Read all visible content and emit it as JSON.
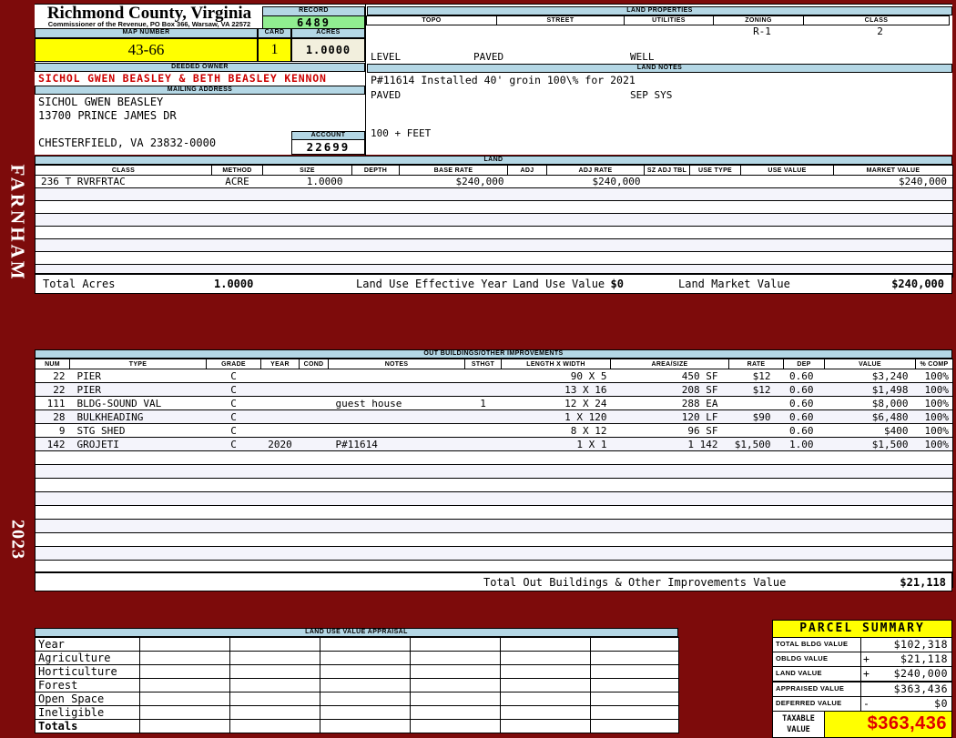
{
  "sidebar": {
    "district": "FARNHAM",
    "year": "2023"
  },
  "header": {
    "county_title": "Richmond County, Virginia",
    "county_subtitle": "Commissioner of the Revenue, PO Box 366, Warsaw, VA 22572",
    "record_label": "RECORD",
    "record_value": "6489",
    "map_number_label": "MAP NUMBER",
    "map_number_value": "43-66",
    "card_label": "CARD",
    "card_value": "1",
    "acres_label": "ACRES",
    "acres_value": "1.0000",
    "deeded_owner_label": "DEEDED OWNER",
    "deeded_owner": "SICHOL GWEN BEASLEY & BETH BEASLEY KENNON",
    "mailing_address_label": "MAILING ADDRESS",
    "mailing_address": [
      "SICHOL GWEN BEASLEY",
      "13700 PRINCE JAMES DR",
      "",
      "CHESTERFIELD, VA 23832-0000"
    ],
    "account_label": "ACCOUNT",
    "account_value": "22699"
  },
  "land_properties": {
    "title": "LAND PROPERTIES",
    "headers": [
      "TOPO",
      "STREET",
      "UTILITIES",
      "ZONING",
      "CLASS"
    ],
    "topo": [
      "LEVEL",
      "PAVED",
      "100 + FEET"
    ],
    "street": [
      "PAVED"
    ],
    "utilities": [
      "WELL",
      "SEP SYS"
    ],
    "zoning": "R-1",
    "class": "2"
  },
  "land_notes": {
    "title": "LAND NOTES",
    "text": "P#11614 Installed 40' groin 100\\% for 2021"
  },
  "land": {
    "title": "LAND",
    "headers": [
      "CLASS",
      "METHOD",
      "SIZE",
      "DEPTH",
      "BASE RATE",
      "ADJ",
      "ADJ RATE",
      "SZ ADJ TBL",
      "USE TYPE",
      "USE VALUE",
      "MARKET VALUE"
    ],
    "rows": [
      [
        "236 T RVRFRTAC",
        "ACRE",
        "1.0000",
        "",
        "$240,000",
        "",
        "$240,000",
        "",
        "",
        "",
        "$240,000"
      ]
    ],
    "totals": {
      "total_acres_label": "Total Acres",
      "total_acres": "1.0000",
      "effective_year_label": "Land Use Effective Year",
      "use_value_label": "Land Use Value",
      "use_value": "$0",
      "market_value_label": "Land Market Value",
      "market_value": "$240,000"
    }
  },
  "outbuildings": {
    "title": "OUT BUILDINGS/OTHER IMPROVEMENTS",
    "headers": [
      "NUM",
      "TYPE",
      "GRADE",
      "YEAR",
      "COND",
      "NOTES",
      "STHGT",
      "LENGTH X WIDTH",
      "AREA/SIZE",
      "RATE",
      "DEP",
      "VALUE",
      "% COMP"
    ],
    "rows": [
      [
        "22",
        "PIER",
        "C",
        "",
        "",
        "",
        "",
        "90 X 5",
        "450 SF",
        "$12",
        "0.60",
        "$3,240",
        "100%"
      ],
      [
        "22",
        "PIER",
        "C",
        "",
        "",
        "",
        "",
        "13 X 16",
        "208 SF",
        "$12",
        "0.60",
        "$1,498",
        "100%"
      ],
      [
        "111",
        "BLDG-SOUND VAL",
        "C",
        "",
        "",
        "guest house",
        "1",
        "12 X 24",
        "288 EA",
        "",
        "0.60",
        "$8,000",
        "100%"
      ],
      [
        "28",
        "BULKHEADING",
        "C",
        "",
        "",
        "",
        "",
        "1 X 120",
        "120 LF",
        "$90",
        "0.60",
        "$6,480",
        "100%"
      ],
      [
        "9",
        "STG SHED",
        "C",
        "",
        "",
        "",
        "",
        "8 X 12",
        "96 SF",
        "",
        "0.60",
        "$400",
        "100%"
      ],
      [
        "142",
        "GROJETI",
        "C",
        "2020",
        "",
        "P#11614",
        "",
        "1 X 1",
        "1 142",
        "$1,500",
        "1.00",
        "$1,500",
        "100%"
      ]
    ],
    "total_label": "Total Out Buildings & Other Improvements Value",
    "total_value": "$21,118"
  },
  "land_use_appraisal": {
    "title": "LAND USE VALUE APPRAISAL",
    "row_labels": [
      "Year",
      "Agriculture",
      "Horticulture",
      "Forest",
      "Open Space",
      "Ineligible",
      "Totals"
    ]
  },
  "parcel_summary": {
    "title": "PARCEL SUMMARY",
    "rows": [
      {
        "label": "TOTAL BLDG VALUE",
        "op": "",
        "value": "$102,318"
      },
      {
        "label": "OBLDG VALUE",
        "op": "+",
        "value": "$21,118"
      },
      {
        "label": "LAND VALUE",
        "op": "+",
        "value": "$240,000"
      },
      {
        "label": "APPRAISED VALUE",
        "op": "",
        "value": "$363,436"
      },
      {
        "label": "DEFERRED VALUE",
        "op": "-",
        "value": "$0"
      }
    ],
    "taxable_label_line1": "TAXABLE",
    "taxable_label_line2": "VALUE",
    "taxable_value": "$363,436"
  }
}
